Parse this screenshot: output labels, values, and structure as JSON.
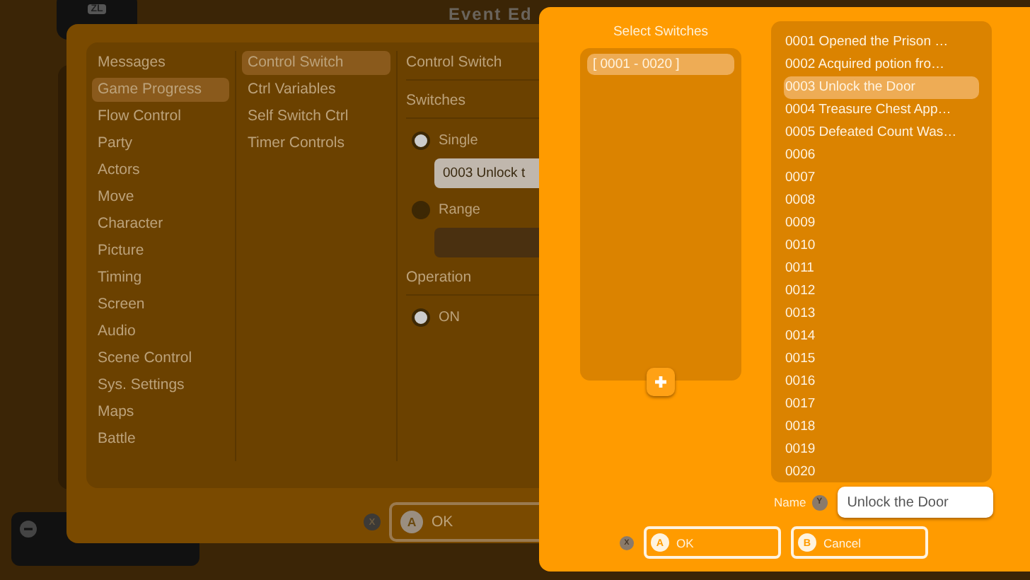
{
  "editor": {
    "title": "Event Ed",
    "tab_key": "ZL"
  },
  "command_dialog": {
    "categories": [
      {
        "label": "Messages",
        "selected": false
      },
      {
        "label": "Game Progress",
        "selected": true
      },
      {
        "label": "Flow Control",
        "selected": false
      },
      {
        "label": "Party",
        "selected": false
      },
      {
        "label": "Actors",
        "selected": false
      },
      {
        "label": "Move",
        "selected": false
      },
      {
        "label": "Character",
        "selected": false
      },
      {
        "label": "Picture",
        "selected": false
      },
      {
        "label": "Timing",
        "selected": false
      },
      {
        "label": "Screen",
        "selected": false
      },
      {
        "label": "Audio",
        "selected": false
      },
      {
        "label": "Scene Control",
        "selected": false
      },
      {
        "label": "Sys. Settings",
        "selected": false
      },
      {
        "label": "Maps",
        "selected": false
      },
      {
        "label": "Battle",
        "selected": false
      }
    ],
    "commands": [
      {
        "label": "Control Switch",
        "selected": true
      },
      {
        "label": "Ctrl Variables",
        "selected": false
      },
      {
        "label": "Self Switch Ctrl",
        "selected": false
      },
      {
        "label": "Timer Controls",
        "selected": false
      }
    ],
    "detail": {
      "title": "Control Switch",
      "switches_label": "Switches",
      "modes": [
        {
          "label": "Single",
          "selected": true,
          "value": "0003 Unlock t"
        },
        {
          "label": "Range",
          "selected": false
        }
      ],
      "operation_label": "Operation",
      "operations": [
        {
          "label": "ON",
          "selected": true
        }
      ]
    },
    "x_key": "X",
    "ok": {
      "key": "A",
      "label": "OK"
    }
  },
  "switch_picker": {
    "title": "Select Switches",
    "groups": [
      {
        "label": "[ 0001 - 0020 ]",
        "selected": true
      }
    ],
    "switches": [
      {
        "label": "0001 Opened the Prison …",
        "selected": false
      },
      {
        "label": "0002 Acquired potion fro…",
        "selected": false
      },
      {
        "label": "0003 Unlock the Door",
        "selected": true
      },
      {
        "label": "0004 Treasure Chest App…",
        "selected": false
      },
      {
        "label": "0005 Defeated Count Was…",
        "selected": false
      },
      {
        "label": "0006",
        "selected": false
      },
      {
        "label": "0007",
        "selected": false
      },
      {
        "label": "0008",
        "selected": false
      },
      {
        "label": "0009",
        "selected": false
      },
      {
        "label": "0010",
        "selected": false
      },
      {
        "label": "0011",
        "selected": false
      },
      {
        "label": "0012",
        "selected": false
      },
      {
        "label": "0013",
        "selected": false
      },
      {
        "label": "0014",
        "selected": false
      },
      {
        "label": "0015",
        "selected": false
      },
      {
        "label": "0016",
        "selected": false
      },
      {
        "label": "0017",
        "selected": false
      },
      {
        "label": "0018",
        "selected": false
      },
      {
        "label": "0019",
        "selected": false
      },
      {
        "label": "0020",
        "selected": false
      }
    ],
    "name_label": "Name",
    "name_key": "Y",
    "name_value": "Unlock the Door",
    "x_key": "X",
    "buttons": [
      {
        "key": "A",
        "label": "OK"
      },
      {
        "key": "B",
        "label": "Cancel"
      }
    ]
  }
}
